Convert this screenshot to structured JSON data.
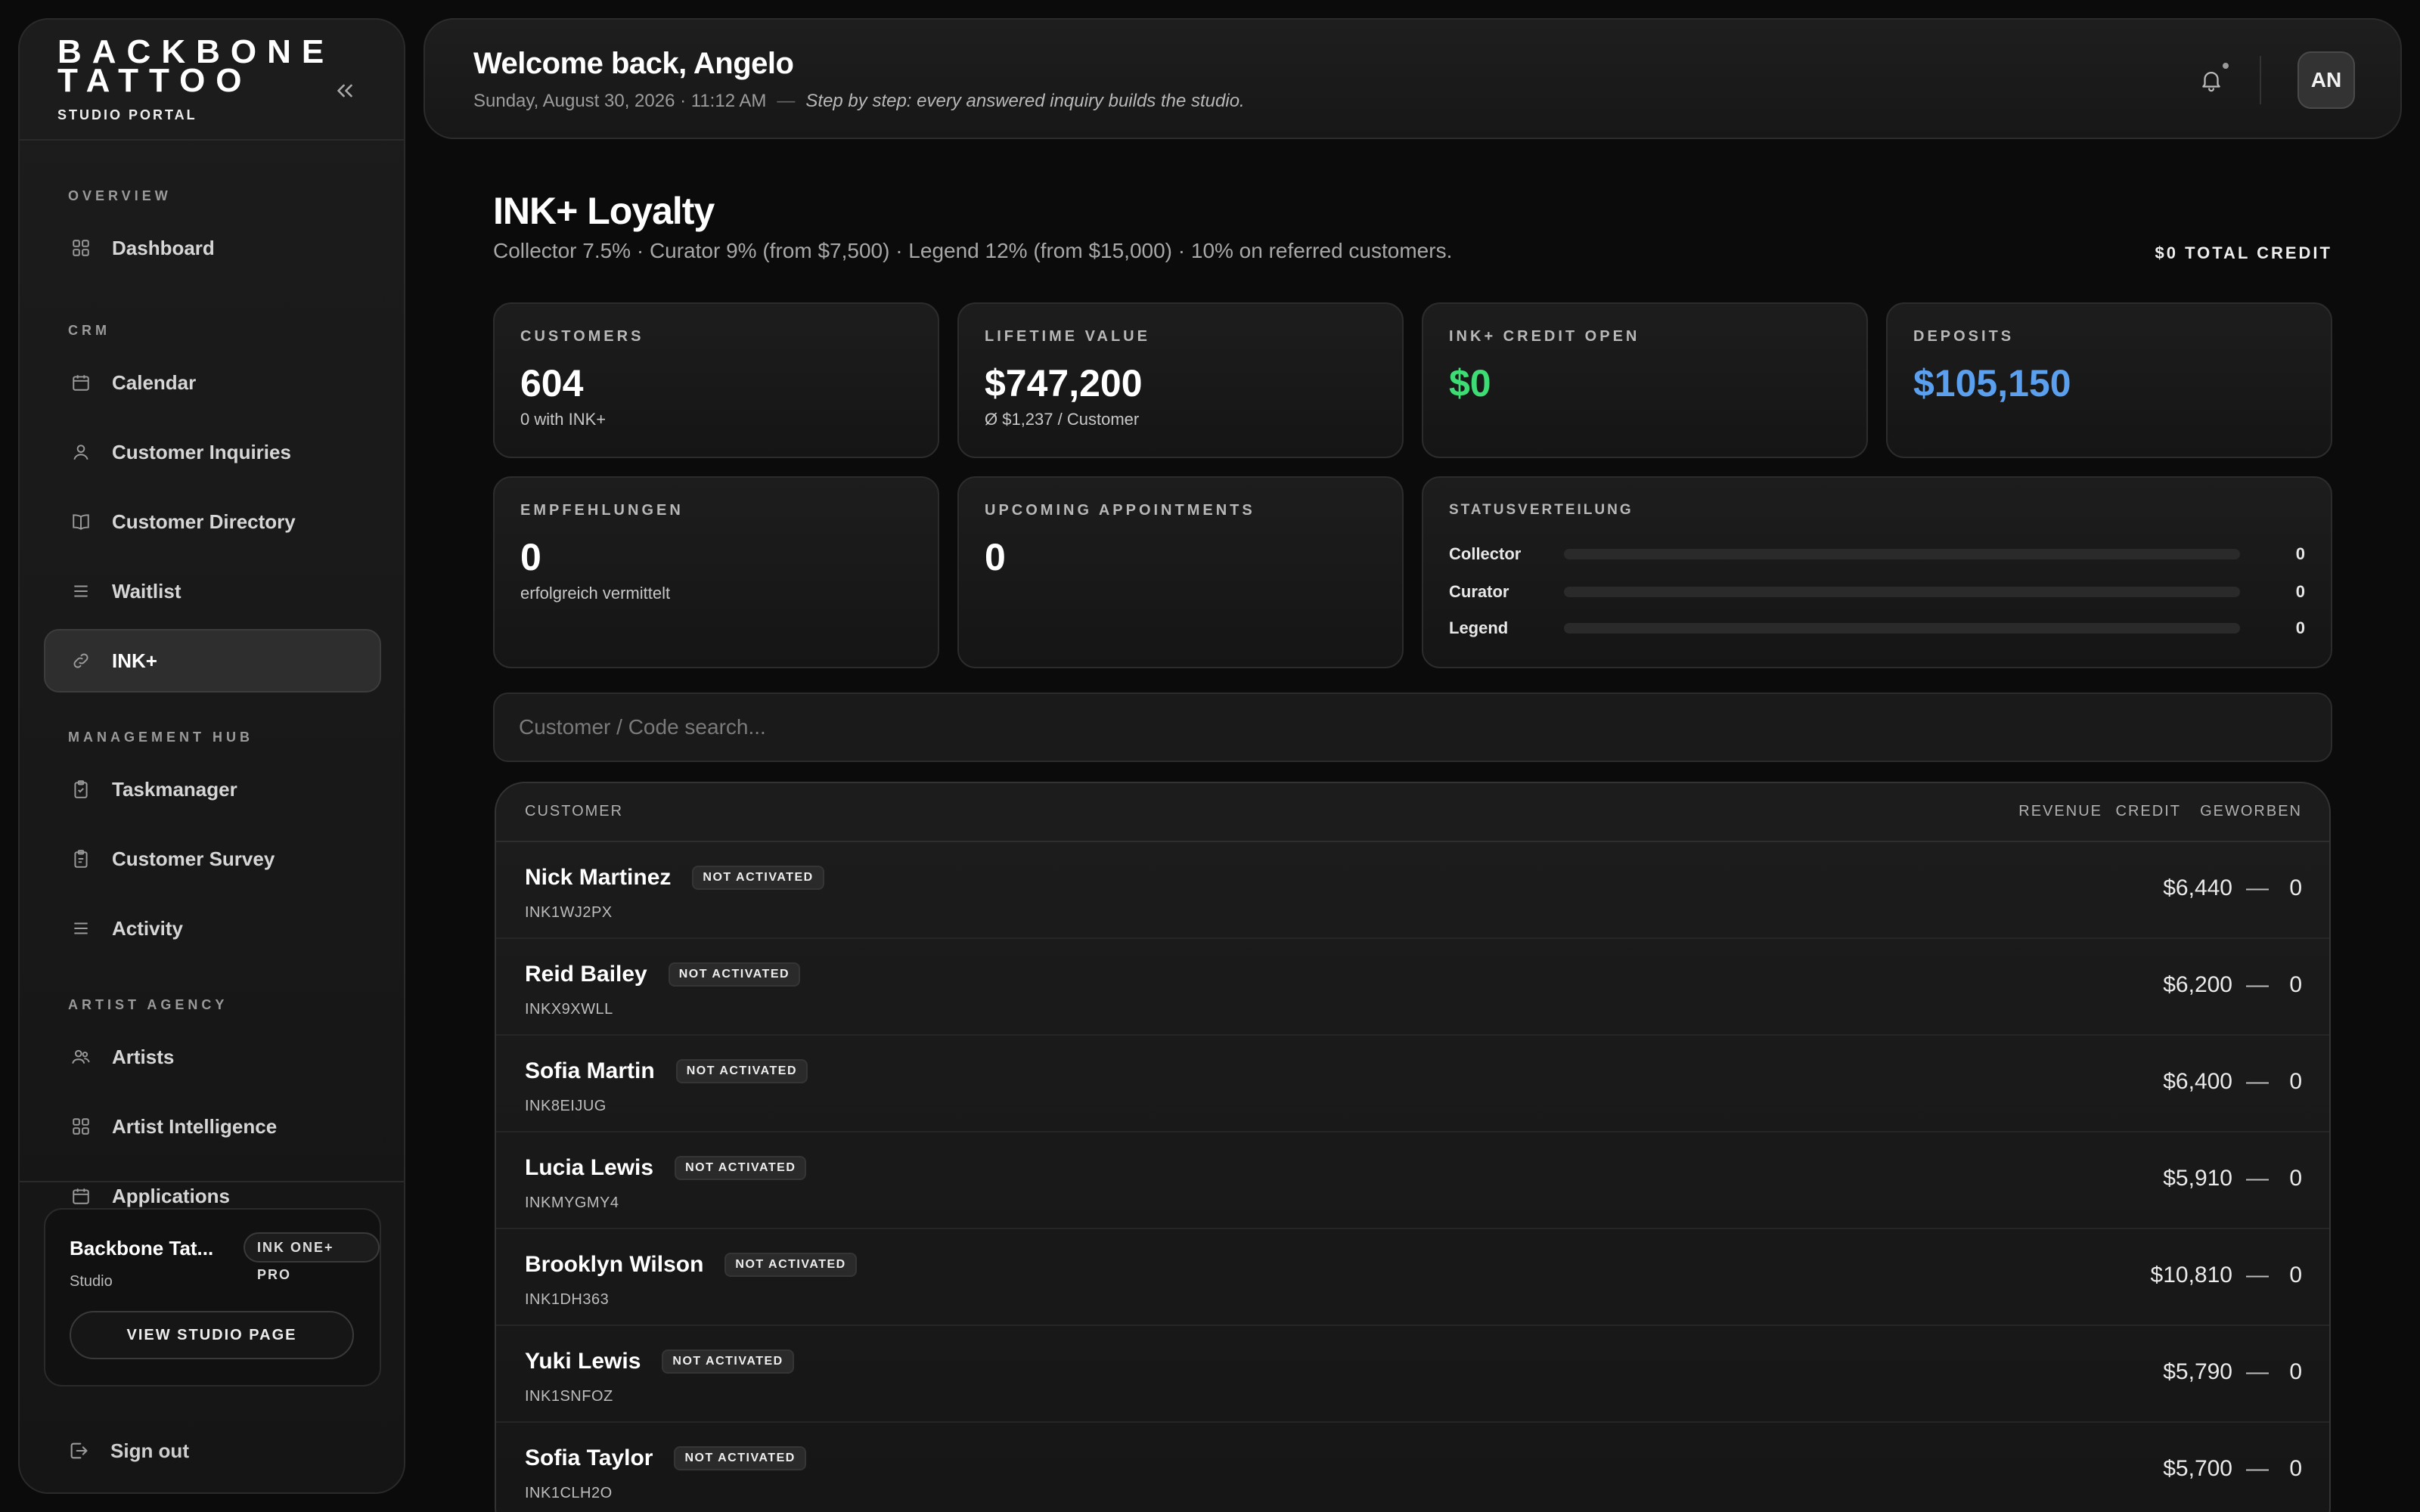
{
  "sidebar": {
    "brand_name": "BACKBONE\nTATTOO",
    "brand_sub": "STUDIO PORTAL",
    "sections": [
      {
        "title": "OVERVIEW",
        "items": [
          {
            "label": "Dashboard",
            "icon": "grid-icon"
          }
        ]
      },
      {
        "title": "CRM",
        "items": [
          {
            "label": "Calendar",
            "icon": "calendar-icon"
          },
          {
            "label": "Customer Inquiries",
            "icon": "user-icon"
          },
          {
            "label": "Customer Directory",
            "icon": "book-icon"
          },
          {
            "label": "Waitlist",
            "icon": "list-icon"
          },
          {
            "label": "INK+",
            "icon": "link-icon",
            "active": true
          }
        ]
      },
      {
        "title": "MANAGEMENT HUB",
        "items": [
          {
            "label": "Taskmanager",
            "icon": "clipboard-icon"
          },
          {
            "label": "Customer Survey",
            "icon": "clipboard-icon"
          },
          {
            "label": "Activity",
            "icon": "list-icon"
          }
        ]
      },
      {
        "title": "ARTIST AGENCY",
        "items": [
          {
            "label": "Artists",
            "icon": "users-icon"
          },
          {
            "label": "Artist Intelligence",
            "icon": "grid-icon"
          },
          {
            "label": "Applications",
            "icon": "calendar-icon"
          }
        ]
      }
    ],
    "studio": {
      "name": "Backbone Tat...",
      "badge": "INK ONE+ PRO",
      "type": "Studio",
      "button": "VIEW STUDIO PAGE"
    },
    "signout": "Sign out"
  },
  "header": {
    "welcome": "Welcome back, Angelo",
    "datetime": "Sunday, August 30, 2026 · 11:12 AM",
    "separator": "—",
    "quote": "Step by step: every answered inquiry builds the studio.",
    "avatar": "AN"
  },
  "page": {
    "title": "INK+ Loyalty",
    "description": "Collector 7.5% · Curator 9% (from $7,500) · Legend 12% (from $15,000) · 10% on referred customers.",
    "total_credit": "$0 TOTAL CREDIT"
  },
  "stats": {
    "customers": {
      "label": "CUSTOMERS",
      "value": "604",
      "sub": "0 with INK+"
    },
    "lifetime": {
      "label": "LIFETIME VALUE",
      "value": "$747,200",
      "sub": "Ø $1,237 / Customer"
    },
    "credit_open": {
      "label": "INK+ CREDIT OPEN",
      "value": "$0",
      "color": "#3ddc74"
    },
    "deposits": {
      "label": "DEPOSITS",
      "value": "$105,150",
      "color": "#5aa0ee"
    },
    "referrals": {
      "label": "EMPFEHLUNGEN",
      "value": "0",
      "sub": "erfolgreich vermittelt"
    },
    "appointments": {
      "label": "UPCOMING APPOINTMENTS",
      "value": "0"
    },
    "distribution": {
      "label": "STATUSVERTEILUNG",
      "rows": [
        {
          "name": "Collector",
          "value": "0"
        },
        {
          "name": "Curator",
          "value": "0"
        },
        {
          "name": "Legend",
          "value": "0"
        }
      ]
    }
  },
  "search": {
    "placeholder": "Customer / Code search..."
  },
  "table": {
    "headers": {
      "customer": "CUSTOMER",
      "revenue": "REVENUE",
      "credit": "CREDIT",
      "referred": "GEWORBEN"
    },
    "rows": [
      {
        "name": "Nick Martinez",
        "status": "NOT ACTIVATED",
        "code": "INK1WJ2PX",
        "revenue": "$6,440",
        "credit": "—",
        "referred": "0"
      },
      {
        "name": "Reid Bailey",
        "status": "NOT ACTIVATED",
        "code": "INKX9XWLL",
        "revenue": "$6,200",
        "credit": "—",
        "referred": "0"
      },
      {
        "name": "Sofia Martin",
        "status": "NOT ACTIVATED",
        "code": "INK8EIJUG",
        "revenue": "$6,400",
        "credit": "—",
        "referred": "0"
      },
      {
        "name": "Lucia Lewis",
        "status": "NOT ACTIVATED",
        "code": "INKMYGMY4",
        "revenue": "$5,910",
        "credit": "—",
        "referred": "0"
      },
      {
        "name": "Brooklyn Wilson",
        "status": "NOT ACTIVATED",
        "code": "INK1DH363",
        "revenue": "$10,810",
        "credit": "—",
        "referred": "0"
      },
      {
        "name": "Yuki Lewis",
        "status": "NOT ACTIVATED",
        "code": "INK1SNFOZ",
        "revenue": "$5,790",
        "credit": "—",
        "referred": "0"
      },
      {
        "name": "Sofia Taylor",
        "status": "NOT ACTIVATED",
        "code": "INK1CLH2O",
        "revenue": "$5,700",
        "credit": "—",
        "referred": "0"
      }
    ]
  }
}
